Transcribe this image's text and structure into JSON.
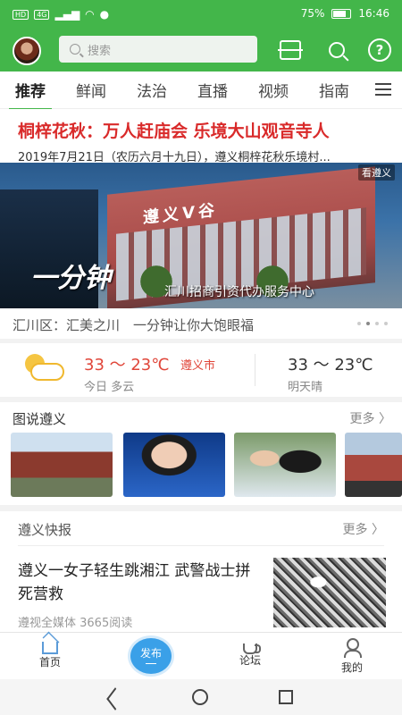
{
  "status_bar": {
    "network_a": "HD",
    "network_b": "4G",
    "battery": "75%",
    "time": "16:46"
  },
  "header": {
    "search_placeholder": "搜索",
    "icons": [
      "avatar",
      "scan-icon",
      "search-icon",
      "help-icon"
    ]
  },
  "tabs": [
    {
      "label": "推荐",
      "active": true
    },
    {
      "label": "鲜闻"
    },
    {
      "label": "法治"
    },
    {
      "label": "直播"
    },
    {
      "label": "视频"
    },
    {
      "label": "指南"
    }
  ],
  "headline": {
    "title": "桐梓花秋：万人赶庙会 乐境大山观音寺人",
    "summary": "2019年7月21日（农历六月十九日），遵义桐梓花秋乐境村..."
  },
  "banner": {
    "sign_text": "遵义V谷",
    "brush_text": "一分钟",
    "caption": "汇川招商引资代办服务中心",
    "logo": "看遵义",
    "slide_caption": "汇川区：汇美之川　一分钟让你大饱眼福",
    "slide_count": 4,
    "active_slide": 2
  },
  "weather": {
    "today_temp": "33 ～ 23℃",
    "city": "遵义市",
    "today_desc": "今日 多云",
    "tomorrow_temp": "33 ～ 23℃",
    "tomorrow_desc": "明天晴"
  },
  "photo_section": {
    "title": "图说遵义",
    "more": "更多 〉"
  },
  "news_section": {
    "title": "遵义快报",
    "more": "更多 〉",
    "items": [
      {
        "title": "遵义一女子轻生跳湘江 武警战士拼死营救",
        "meta": "遵视全媒体 3665阅读"
      }
    ]
  },
  "bottom_nav": {
    "home": "首页",
    "publish": "发布",
    "forum": "论坛",
    "mine": "我的"
  },
  "colors": {
    "brand_green": "#43b64a",
    "headline_red": "#d92a2a",
    "temp_red": "#e0463a",
    "publish_blue": "#3aa0e8"
  }
}
